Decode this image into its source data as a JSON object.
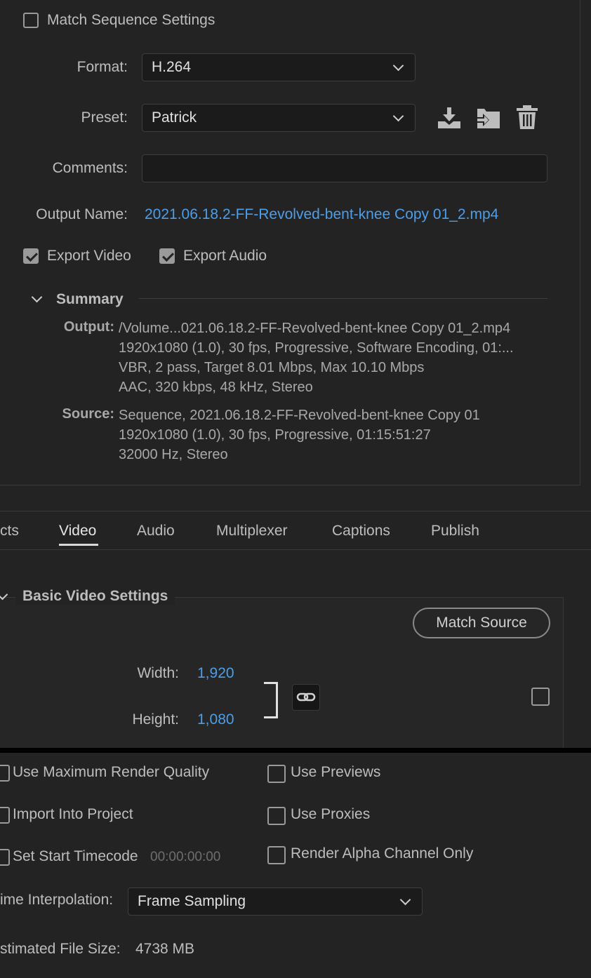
{
  "top": {
    "match_sequence": "Match Sequence Settings",
    "format_label": "Format:",
    "format_value": "H.264",
    "preset_label": "Preset:",
    "preset_value": "Patrick",
    "comments_label": "Comments:",
    "comments_value": "",
    "output_name_label": "Output Name:",
    "output_name_value": "2021.06.18.2-FF-Revolved-bent-knee Copy 01_2.mp4",
    "export_video": "Export Video",
    "export_audio": "Export Audio",
    "summary_title": "Summary",
    "output_key": "Output:",
    "output_lines": [
      "/Volume...021.06.18.2-FF-Revolved-bent-knee Copy 01_2.mp4",
      "1920x1080 (1.0), 30 fps, Progressive, Software Encoding, 01:...",
      "VBR, 2 pass, Target 8.01 Mbps, Max 10.10 Mbps",
      "AAC, 320 kbps, 48 kHz, Stereo"
    ],
    "source_key": "Source:",
    "source_lines": [
      "Sequence, 2021.06.18.2-FF-Revolved-bent-knee Copy 01",
      "1920x1080 (1.0), 30 fps, Progressive, 01:15:51:27",
      "32000 Hz, Stereo"
    ]
  },
  "tabs": [
    "cts",
    "Video",
    "Audio",
    "Multiplexer",
    "Captions",
    "Publish"
  ],
  "video": {
    "section_title": "Basic Video Settings",
    "match_source": "Match Source",
    "width_label": "Width:",
    "width_value": "1,920",
    "height_label": "Height:",
    "height_value": "1,080"
  },
  "bottom": {
    "use_max_render": "Use Maximum Render Quality",
    "use_previews": "Use Previews",
    "import_into_project": "Import Into Project",
    "use_proxies": "Use Proxies",
    "set_start_timecode": "Set Start Timecode",
    "timecode_value": "00:00:00:00",
    "render_alpha": "Render Alpha Channel Only",
    "interp_label": "ime Interpolation:",
    "interp_value": "Frame Sampling",
    "file_size_label": "stimated File Size:",
    "file_size_value": "4738 MB"
  },
  "icons": [
    "save-preset-icon",
    "import-preset-icon",
    "delete-preset-icon",
    "link-icon",
    "chevron-down-icon"
  ],
  "colors": {
    "background": "#232323",
    "link": "#4d9ee8",
    "text": "#bdbdbd"
  }
}
